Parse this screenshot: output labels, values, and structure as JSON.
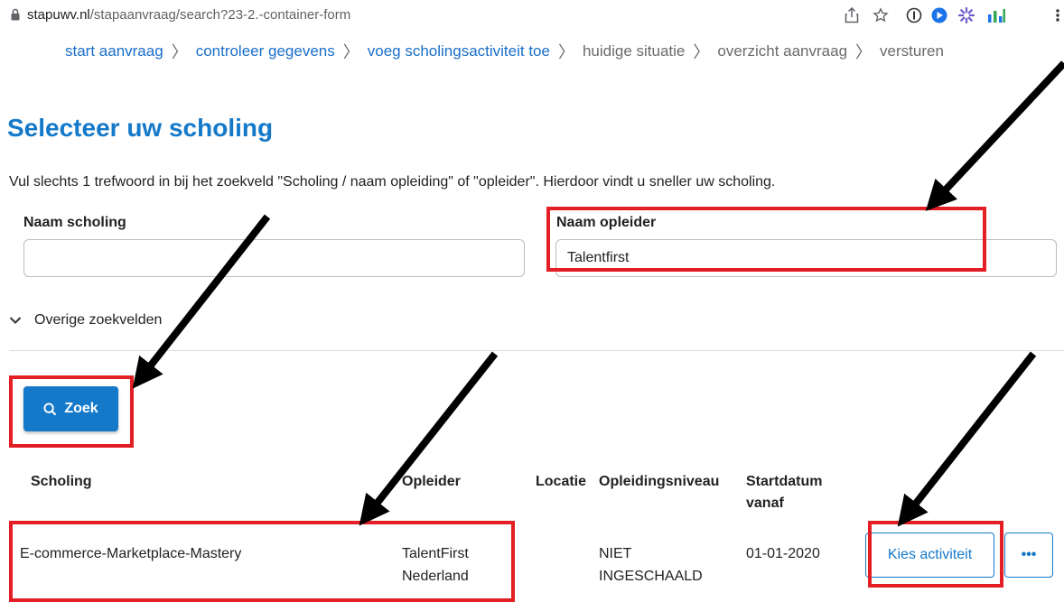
{
  "browser": {
    "url_host": "stapuwv.nl",
    "url_path": "/stapaanvraag/search?23-2.-container-form",
    "icons": [
      "share-icon",
      "star-icon",
      "password-icon",
      "extension-icon",
      "puzzle-icon",
      "analytics-icon"
    ]
  },
  "breadcrumb": [
    {
      "label": "start aanvraag",
      "link": true
    },
    {
      "label": "controleer gegevens",
      "link": true
    },
    {
      "label": "voeg scholingsactiviteit toe",
      "link": true
    },
    {
      "label": "huidige situatie",
      "link": false
    },
    {
      "label": "overzicht aanvraag",
      "link": false
    },
    {
      "label": "versturen",
      "link": false
    }
  ],
  "page": {
    "title": "Selecteer uw scholing",
    "intro": "Vul slechts 1 trefwoord in bij het zoekveld \"Scholing / naam opleiding\" of \"opleider\". Hierdoor vindt u sneller uw scholing."
  },
  "form": {
    "naam_scholing_label": "Naam scholing",
    "naam_scholing_value": "",
    "naam_opleider_label": "Naam opleider",
    "naam_opleider_value": "Talentfirst",
    "more_fields": "Overige zoekvelden",
    "search_button": "Zoek"
  },
  "table": {
    "headers": {
      "scholing": "Scholing",
      "opleider": "Opleider",
      "locatie": "Locatie",
      "niveau": "Opleidingsniveau",
      "startdatum_1": "Startdatum",
      "startdatum_2": "vanaf"
    },
    "rows": [
      {
        "scholing": "E-commerce-Marketplace-Mastery",
        "opleider_1": "TalentFirst",
        "opleider_2": "Nederland",
        "locatie": "",
        "niveau_1": "NIET",
        "niveau_2": "INGESCHAALD",
        "startdatum": "01-01-2020",
        "action": "Kies activiteit",
        "more": "•••"
      }
    ]
  },
  "colors": {
    "accent": "#1479c9",
    "highlight": "#e31e24",
    "annotation_arrow": "#000000"
  }
}
